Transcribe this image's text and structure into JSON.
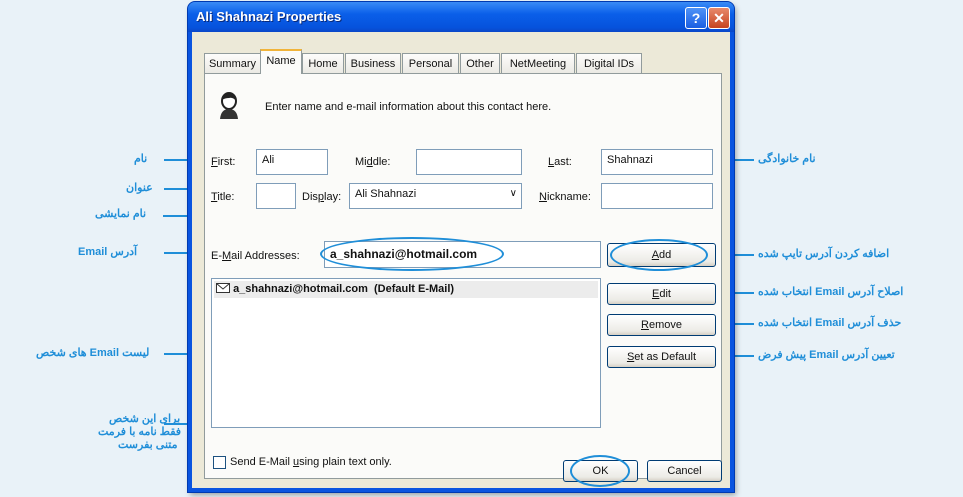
{
  "window": {
    "title": "Ali Shahnazi Properties",
    "help_glyph": "?",
    "close_glyph": "✕"
  },
  "tabs": [
    {
      "label": "Summary"
    },
    {
      "label": "Name"
    },
    {
      "label": "Home"
    },
    {
      "label": "Business"
    },
    {
      "label": "Personal"
    },
    {
      "label": "Other"
    },
    {
      "label": "NetMeeting"
    },
    {
      "label": "Digital IDs"
    }
  ],
  "header": {
    "icon": "contact-card-icon",
    "description": "Enter name and e-mail information about this contact here."
  },
  "name": {
    "first_label_key": "F",
    "first_label_rest": "irst:",
    "first_value": "Ali",
    "middle_label_pre": "Mi",
    "middle_label_key": "d",
    "middle_label_rest": "dle:",
    "middle_value": "",
    "last_label_key": "L",
    "last_label_rest": "ast:",
    "last_value": "Shahnazi",
    "title_label_key": "T",
    "title_label_rest": "itle:",
    "title_value": "",
    "display_label_pre": "Dis",
    "display_label_key": "p",
    "display_label_rest": "lay:",
    "display_value": "Ali Shahnazi",
    "nickname_label_key": "N",
    "nickname_label_rest": "ickname:",
    "nickname_value": ""
  },
  "email": {
    "addresses_label_pre": "E-",
    "addresses_label_key": "M",
    "addresses_label_rest": "ail Addresses:",
    "input_value": "a_shahnazi@hotmail.com",
    "add_label_key": "A",
    "add_label_rest": "dd",
    "list": [
      {
        "text": "a_shahnazi@hotmail.com  (Default E-Mail)"
      }
    ],
    "edit_label_key": "E",
    "edit_label_rest": "dit",
    "remove_label_key": "R",
    "remove_label_rest": "emove",
    "set_default_label_key": "S",
    "set_default_label_rest": "et as Default",
    "plain_text_label_pre": "Send E-Mail ",
    "plain_text_label_key": "u",
    "plain_text_label_rest": "sing plain text only.",
    "plain_text_checked": false
  },
  "footer": {
    "ok_label": "OK",
    "cancel_label": "Cancel"
  },
  "annotations": {
    "first": "نام",
    "title": "عنوان",
    "display": "نام نمایشی",
    "email_address": "آدرس Email",
    "email_list": "لیست Email های شخص",
    "plain_text_1": "برای این شخص",
    "plain_text_2": "فقط نامه با فرمت",
    "plain_text_3": "متنی بفرست",
    "last": "نام خانوادگی",
    "add": "اضافه کردن آدرس تایپ شده",
    "edit": "اصلاح آدرس Email انتخاب شده",
    "remove": "حذف آدرس Email انتخاب شده",
    "set_default": "تعیین آدرس Email پیش فرض"
  },
  "colors": {
    "annotation": "#1f8ed8",
    "titlebar": "#0a5fe9",
    "dialog_bg": "#ece9d8"
  }
}
